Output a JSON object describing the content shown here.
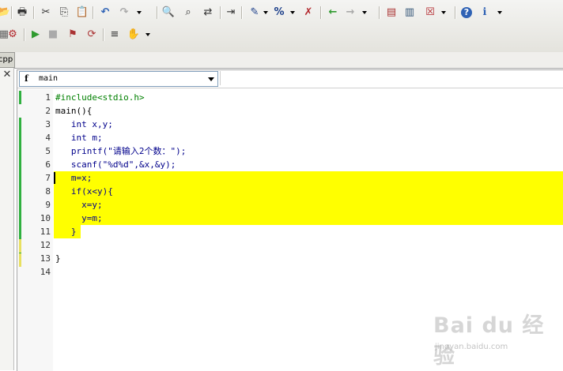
{
  "toolbar": {
    "row1": [
      {
        "icon": "open-icon",
        "glyph": "📂"
      },
      {
        "icon": "print-icon",
        "glyph": "🖶"
      },
      {
        "icon": "cut-icon",
        "glyph": "✂"
      },
      {
        "icon": "copy-icon",
        "glyph": "⎘"
      },
      {
        "icon": "paste-icon",
        "glyph": "📋"
      },
      {
        "icon": "undo-icon",
        "glyph": "↶"
      },
      {
        "icon": "redo-icon",
        "glyph": "↷"
      },
      {
        "icon": "find-icon",
        "glyph": "🔍"
      },
      {
        "icon": "find-next-icon",
        "glyph": "⌕"
      },
      {
        "icon": "replace-icon",
        "glyph": "⇄"
      },
      {
        "icon": "goto-line-icon",
        "glyph": "⇥"
      },
      {
        "icon": "bookmark-icon",
        "glyph": "✎"
      },
      {
        "icon": "toggle-bookmark-icon",
        "glyph": "%"
      },
      {
        "icon": "clear-bookmark-icon",
        "glyph": "✗"
      },
      {
        "icon": "back-icon",
        "glyph": "←"
      },
      {
        "icon": "forward-icon",
        "glyph": "→"
      },
      {
        "icon": "new-project-icon",
        "glyph": "▤"
      },
      {
        "icon": "open-project-icon",
        "glyph": "▥"
      },
      {
        "icon": "close-project-icon",
        "glyph": "☒"
      },
      {
        "icon": "help-icon",
        "glyph": "?"
      },
      {
        "icon": "about-icon",
        "glyph": "ℹ"
      }
    ],
    "row2": [
      {
        "icon": "compile-run-icon",
        "glyph": "⚙"
      },
      {
        "icon": "run-icon",
        "glyph": "▶"
      },
      {
        "icon": "stop-icon",
        "glyph": "■"
      },
      {
        "icon": "debug-icon",
        "glyph": "⚑"
      },
      {
        "icon": "rebuild-icon",
        "glyph": "⟳"
      },
      {
        "icon": "report-icon",
        "glyph": "≡"
      },
      {
        "icon": "hand-icon",
        "glyph": "✋"
      }
    ]
  },
  "project_tab": {
    "label": "cpp"
  },
  "close_pane": {
    "glyph": "✕"
  },
  "function_combo": {
    "icon": "f",
    "value": "main"
  },
  "editor": {
    "line_numbers": [
      "1",
      "2",
      "3",
      "4",
      "5",
      "6",
      "7",
      "8",
      "9",
      "10",
      "11",
      "12",
      "13",
      "14"
    ],
    "lines": [
      "#include<stdio.h>",
      "main(){",
      "   int x,y;",
      "   int m;",
      "   printf(\"请输入2个数：\");",
      "   scanf(\"%d%d\",&x,&y);",
      "   m=x;",
      "   if(x<y){",
      "     x=y;",
      "     y=m;",
      "   }",
      "",
      "}",
      ""
    ],
    "highlight_color": "#ffff00",
    "selected_lines": [
      "7",
      "8",
      "9",
      "10",
      "11"
    ]
  },
  "watermark": {
    "text": "Bai du 经验",
    "url": "jingyan.baidu.com"
  }
}
